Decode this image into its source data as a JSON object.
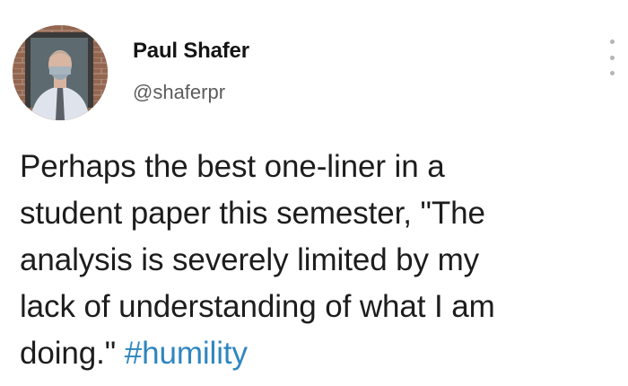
{
  "tweet": {
    "author": {
      "display_name": "Paul Shafer",
      "handle": "@shaferpr"
    },
    "body_lines": [
      "Perhaps the best one-liner in a",
      "student paper this semester, \"The",
      "analysis is severely limited by my",
      "lack of understanding of what I am"
    ],
    "last_line_text": "doing.\" ",
    "hashtag": "#humility",
    "icons": {
      "more": "more-vertical-icon",
      "avatar": "avatar"
    },
    "colors": {
      "hashtag": "#2f86c0",
      "text": "#1d1d1d",
      "handle": "#5c5c5c"
    }
  }
}
